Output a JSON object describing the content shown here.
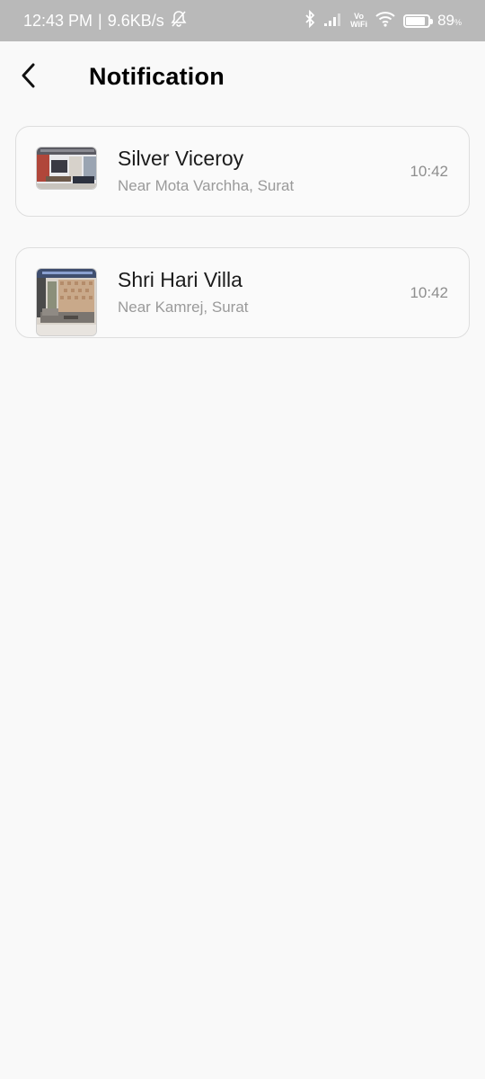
{
  "status_bar": {
    "time": "12:43 PM",
    "speed": "9.6KB/s",
    "vowifi_top": "Vo",
    "vowifi_bottom": "WiFi",
    "battery": "89",
    "battery_unit": "%",
    "battery_level": 0.89,
    "icons": [
      "bell-muted-icon",
      "bluetooth-icon",
      "signal-icon",
      "wifi-icon",
      "battery-icon"
    ]
  },
  "header": {
    "title": "Notification",
    "back_icon": "chevron-left-icon"
  },
  "notifications": [
    {
      "title": "Silver Viceroy",
      "subtitle": "Near Mota Varchha, Surat",
      "time": "10:42",
      "image": "living-room-thumbnail"
    },
    {
      "title": "Shri Hari Villa",
      "subtitle": "Near Kamrej, Surat",
      "time": "10:42",
      "image": "villa-interior-thumbnail"
    }
  ],
  "colors": {
    "status_bar_bg": "#b9b9b9",
    "page_bg": "#f9f9f9",
    "card_border": "#dedede",
    "subtitle": "#9a9a9a"
  }
}
